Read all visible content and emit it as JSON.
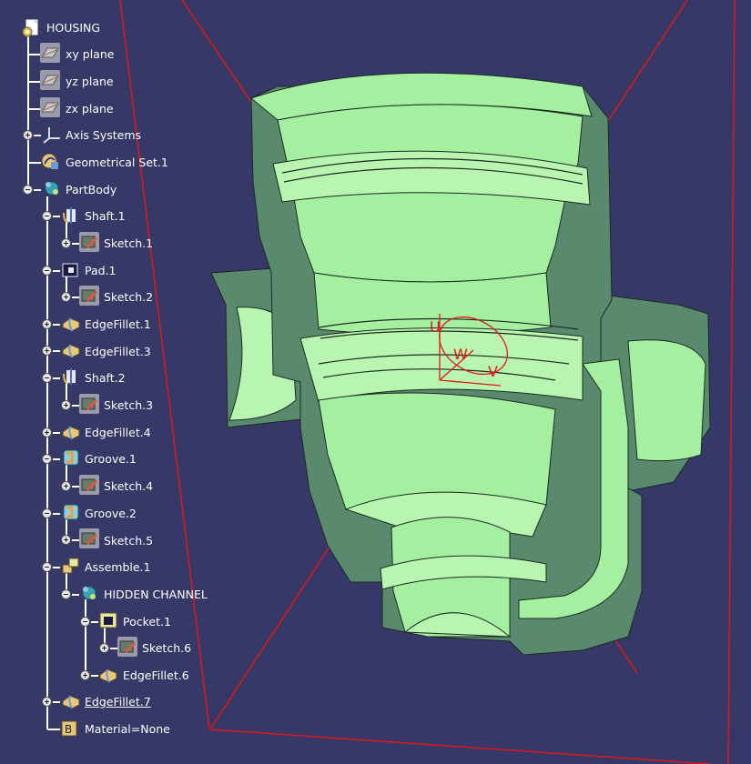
{
  "colors": {
    "background": "#363867",
    "tree_text": "#ffffff",
    "part_face": "#a4f0a0",
    "part_cut": "#5a8a6e",
    "bounding_box": "#e01818",
    "axis": "#e01818"
  },
  "tree": {
    "root": {
      "label": "HOUSING",
      "icon": "part-document-icon"
    },
    "items": [
      {
        "label": "xy plane",
        "icon": "plane-icon"
      },
      {
        "label": "yz plane",
        "icon": "plane-icon"
      },
      {
        "label": "zx plane",
        "icon": "plane-icon"
      },
      {
        "label": "Axis Systems",
        "icon": "axis-system-icon"
      },
      {
        "label": "Geometrical Set.1",
        "icon": "geometrical-set-icon"
      },
      {
        "label": "PartBody",
        "icon": "body-icon"
      },
      {
        "label": "Shaft.1",
        "icon": "shaft-icon"
      },
      {
        "label": "Sketch.1",
        "icon": "sketch-icon"
      },
      {
        "label": "Pad.1",
        "icon": "pad-icon"
      },
      {
        "label": "Sketch.2",
        "icon": "sketch-icon"
      },
      {
        "label": "EdgeFillet.1",
        "icon": "edge-fillet-icon"
      },
      {
        "label": "EdgeFillet.3",
        "icon": "edge-fillet-icon"
      },
      {
        "label": "Shaft.2",
        "icon": "shaft-icon"
      },
      {
        "label": "Sketch.3",
        "icon": "sketch-icon"
      },
      {
        "label": "EdgeFillet.4",
        "icon": "edge-fillet-icon"
      },
      {
        "label": "Groove.1",
        "icon": "groove-icon"
      },
      {
        "label": "Sketch.4",
        "icon": "sketch-icon"
      },
      {
        "label": "Groove.2",
        "icon": "groove-icon"
      },
      {
        "label": "Sketch.5",
        "icon": "sketch-icon"
      },
      {
        "label": "Assemble.1",
        "icon": "assemble-icon"
      },
      {
        "label": "HIDDEN CHANNEL",
        "icon": "body-icon"
      },
      {
        "label": "Pocket.1",
        "icon": "pocket-icon"
      },
      {
        "label": "Sketch.6",
        "icon": "sketch-icon"
      },
      {
        "label": "EdgeFillet.6",
        "icon": "edge-fillet-icon"
      },
      {
        "label": "EdgeFillet.7",
        "icon": "edge-fillet-icon"
      },
      {
        "label": "Material=None",
        "icon": "material-icon"
      }
    ]
  },
  "compass": {
    "u_label": "U",
    "w_label": "W",
    "v_label": "V"
  }
}
